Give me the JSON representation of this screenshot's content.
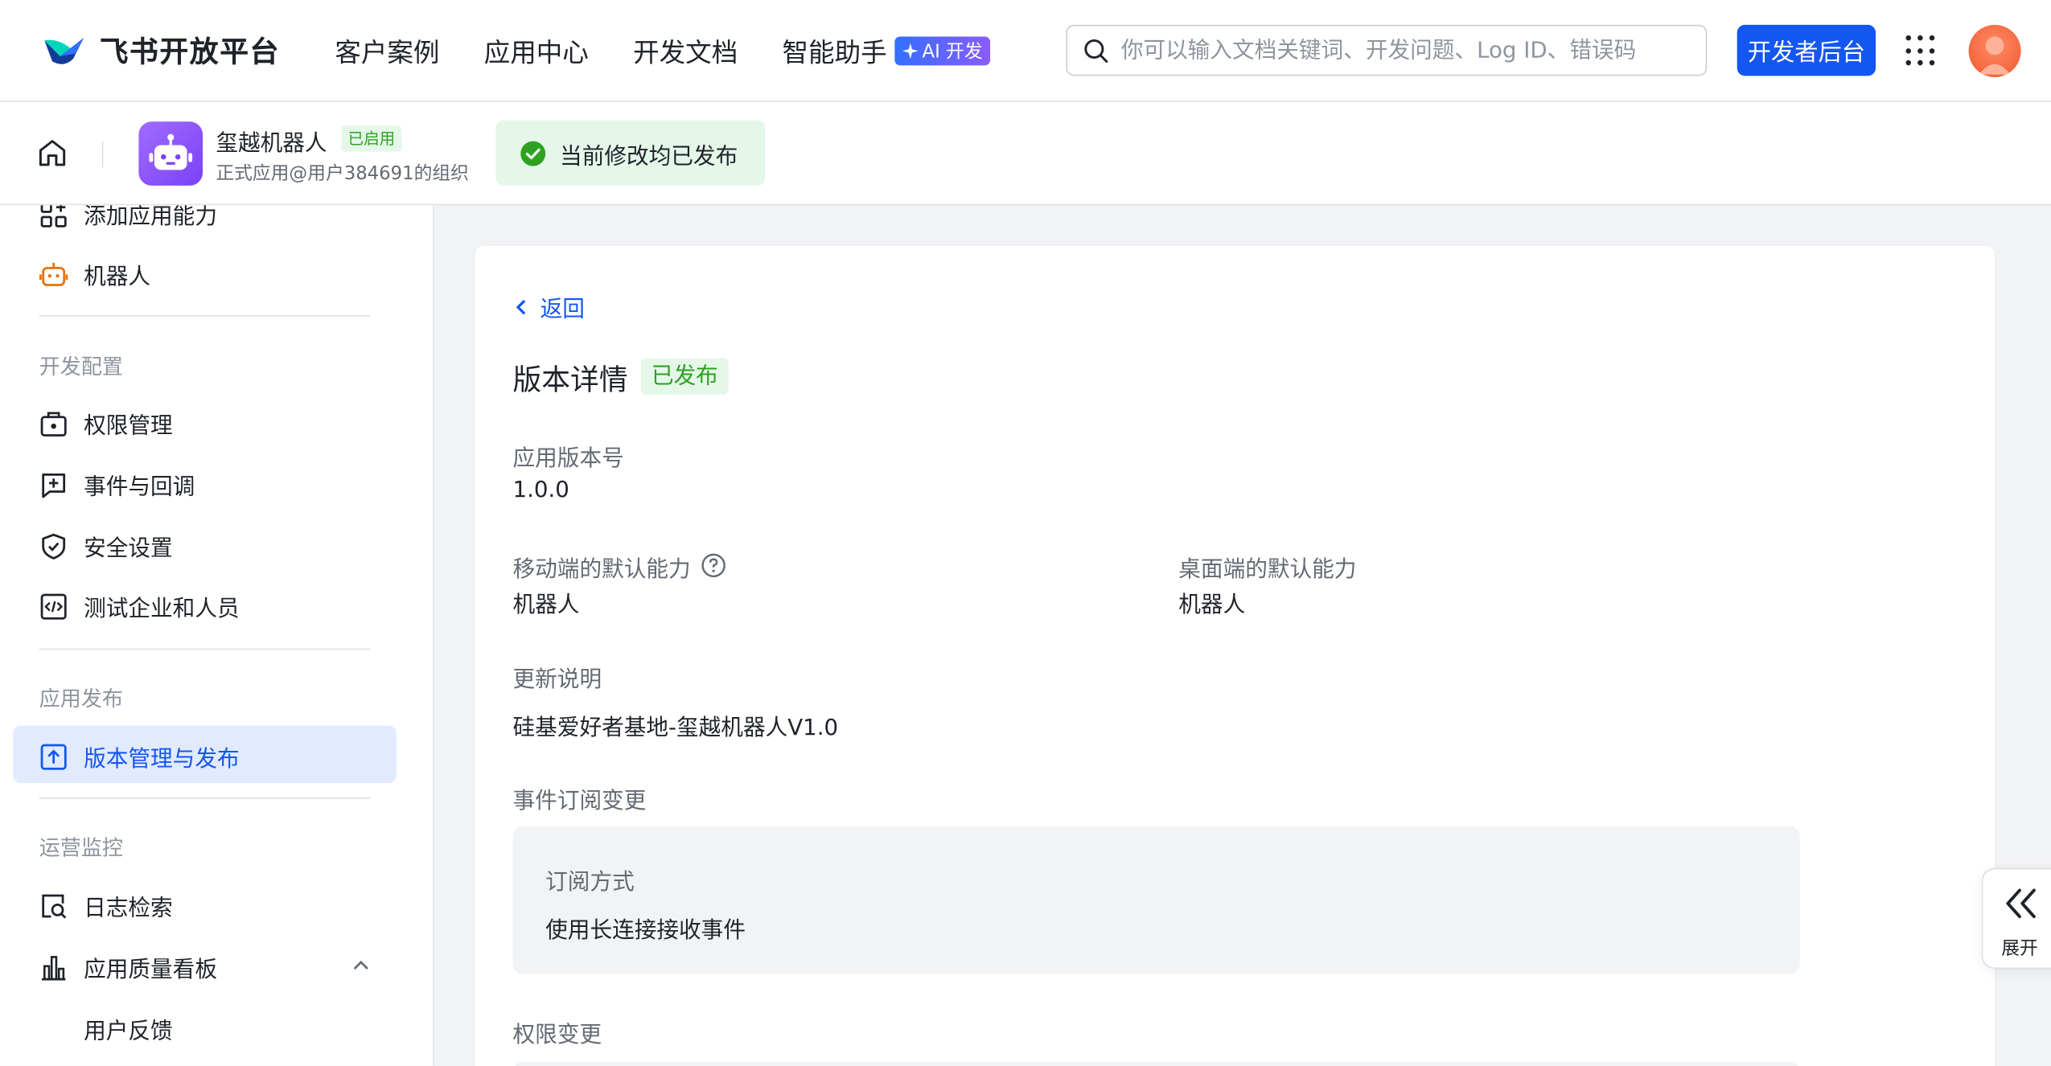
{
  "topbar": {
    "brand": "飞书开放平台",
    "nav": [
      "客户案例",
      "应用中心",
      "开发文档",
      "智能助手"
    ],
    "ai_badge": "AI 开发",
    "search_placeholder": "你可以输入文档关键词、开发问题、Log ID、错误码",
    "developer_button": "开发者后台"
  },
  "appbar": {
    "app_name": "玺越机器人",
    "app_status": "已启用",
    "app_org": "正式应用@用户384691的组织",
    "publish_tip": "当前修改均已发布"
  },
  "sidebar": {
    "items_top": [
      "添加应用能力",
      "机器人"
    ],
    "section_dev": "开发配置",
    "dev_items": [
      "权限管理",
      "事件与回调",
      "安全设置",
      "测试企业和人员"
    ],
    "section_release": "应用发布",
    "release_item": "版本管理与发布",
    "section_ops": "运营监控",
    "ops_items": [
      "日志检索",
      "应用质量看板"
    ],
    "ops_sub_item": "用户反馈"
  },
  "detail": {
    "back": "返回",
    "title": "版本详情",
    "status": "已发布",
    "version_label": "应用版本号",
    "version_value": "1.0.0",
    "mobile_label": "移动端的默认能力",
    "mobile_value": "机器人",
    "desktop_label": "桌面端的默认能力",
    "desktop_value": "机器人",
    "notes_label": "更新说明",
    "notes_value": "硅基爱好者基地-玺越机器人V1.0",
    "event_label": "事件订阅变更",
    "sub_method_label": "订阅方式",
    "sub_method_value": "使用长连接接收事件",
    "perm_label": "权限变更"
  },
  "expand": {
    "label": "展开"
  },
  "colors": {
    "primary": "#1456f0",
    "success": "#2ea121",
    "success_bg": "#e4f7e9",
    "active_bg": "#e1eaff"
  }
}
